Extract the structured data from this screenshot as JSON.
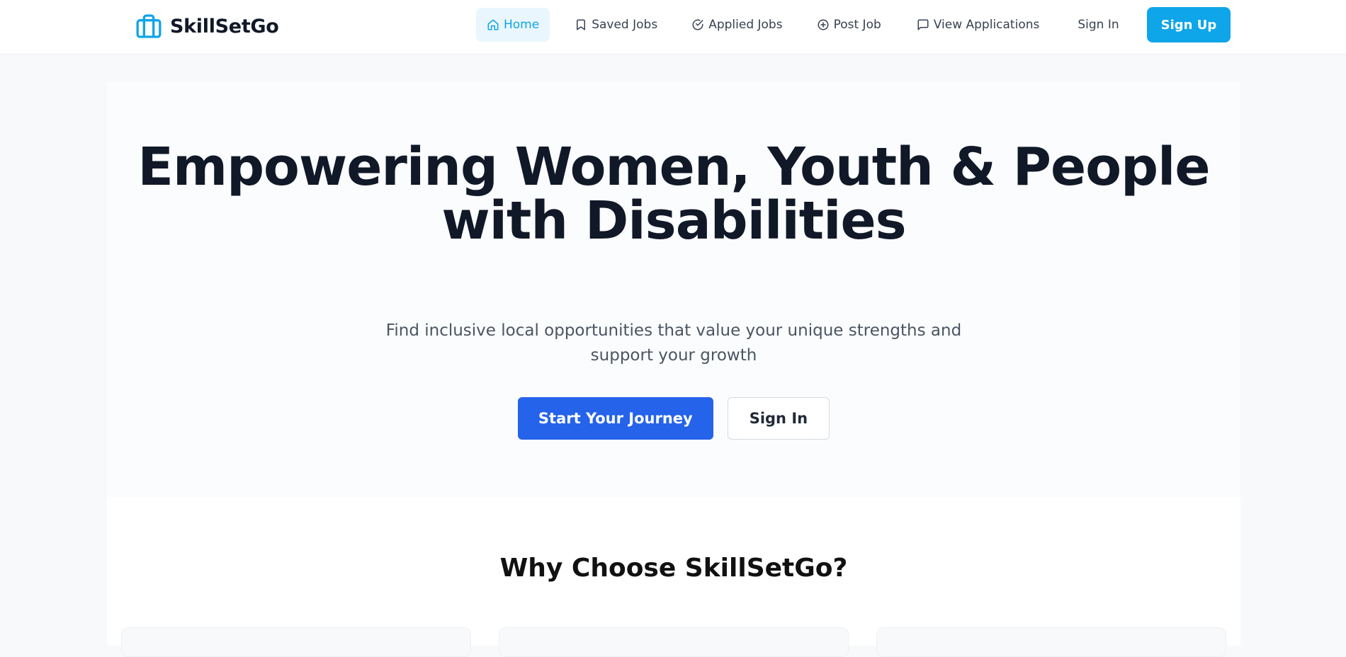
{
  "brand": {
    "name": "SkillSetGo",
    "logo_icon": "briefcase-icon",
    "accent_color": "#0ea5e9"
  },
  "nav": {
    "items": [
      {
        "label": "Home",
        "icon": "home-icon",
        "active": true
      },
      {
        "label": "Saved Jobs",
        "icon": "bookmark-icon",
        "active": false
      },
      {
        "label": "Applied Jobs",
        "icon": "check-circle-icon",
        "active": false
      },
      {
        "label": "Post Job",
        "icon": "plus-circle-icon",
        "active": false
      },
      {
        "label": "View Applications",
        "icon": "message-icon",
        "active": false
      }
    ],
    "sign_in": "Sign In",
    "sign_up": "Sign Up"
  },
  "hero": {
    "title": "Empowering Women, Youth & People with Disabilities",
    "subtitle": "Find inclusive local opportunities that value your unique strengths and support your growth",
    "primary_cta": "Start Your Journey",
    "secondary_cta": "Sign In",
    "primary_color": "#2563eb"
  },
  "why": {
    "title": "Why Choose SkillSetGo?"
  }
}
